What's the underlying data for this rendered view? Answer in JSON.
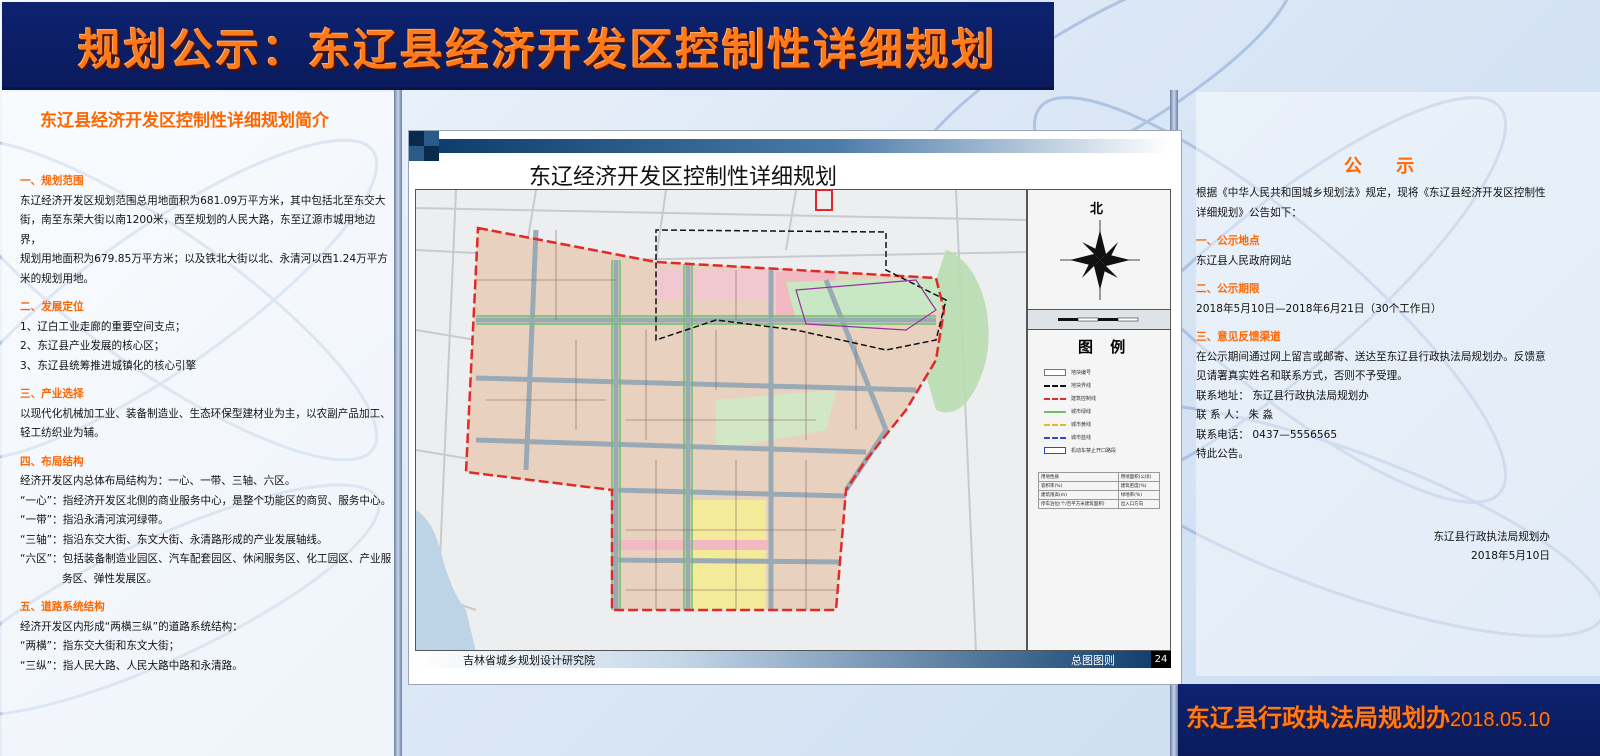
{
  "header": {
    "title": "规划公示：东辽县经济开发区控制性详细规划"
  },
  "intro": {
    "title": "东辽县经济开发区控制性详细规划简介",
    "sections": [
      {
        "heading": "一、规划范围",
        "lines": [
          "东辽经济开发区规划范围总用地面积为681.09万平方米，其中包括北至东交大",
          "街，南至东荣大街以南1200米，西至规划的人民大路，东至辽源市城用地边界，",
          "规划用地面积为679.85万平方米；以及铁北大街以北、永清河以西1.24万平方",
          "米的规划用地。"
        ]
      },
      {
        "heading": "二、发展定位",
        "lines": [
          "1、辽白工业走廊的重要空间支点；",
          "2、东辽县产业发展的核心区；",
          "3、东辽县统筹推进城镇化的核心引擎"
        ]
      },
      {
        "heading": "三、产业选择",
        "lines": [
          "以现代化机械加工业、装备制造业、生态环保型建材业为主，以农副产品加工、",
          "轻工纺织业为辅。"
        ]
      },
      {
        "heading": "四、布局结构",
        "lines": [
          "经济开发区内总体布局结构为：一心、一带、三轴、六区。",
          "“一心”：指经济开发区北侧的商业服务中心，是整个功能区的商贸、服务中心。",
          "“一带”：指沿永清河滨河绿带。",
          "“三轴”：指沿东交大街、东文大街、永清路形成的产业发展轴线。",
          "“六区”：包括装备制造业园区、汽车配套园区、休闲服务区、化工园区、产业服",
          "务区、弹性发展区。"
        ]
      },
      {
        "heading": "五、道路系统结构",
        "lines": [
          "经济开发区内形成“两横三纵”的道路系统结构：",
          "“两横”：指东交大街和东文大街；",
          "“三纵”：指人民大路、人民大路中路和永清路。"
        ]
      }
    ]
  },
  "map": {
    "title": "东辽经济开发区控制性详细规划",
    "north_label": "北",
    "legend_title": "图 例",
    "legend_items": [
      "地块编号",
      "地块界线",
      "建筑控制线",
      "城市绿线",
      "城市黄线",
      "城市蓝线",
      "机动车禁止开口路段"
    ],
    "stats_rows": [
      [
        "用地性质",
        "用地面积(公顷)"
      ],
      [
        "容积率(%)",
        "建筑密度(%)"
      ],
      [
        "建筑限高(m)",
        "绿地率(%)"
      ],
      [
        "停车泊位(个/百平方米建筑面积)",
        "出入口方向"
      ]
    ],
    "institute": "吉林省城乡规划设计研究院",
    "drawing_name": "总图图则",
    "page_number": "24"
  },
  "notice": {
    "heading": "公 示",
    "intro_lines": [
      "根据《中华人民共和国城乡规划法》规定，现将《东辽县经济开发区控制性",
      "详细规划》公告如下："
    ],
    "sections": [
      {
        "heading": "一、公示地点",
        "lines": [
          "东辽县人民政府网站"
        ]
      },
      {
        "heading": "二、公示期限",
        "lines": [
          "2018年5月10日—2018年6月21日（30个工作日）"
        ]
      },
      {
        "heading": "三、意见反馈渠道",
        "lines": [
          "在公示期间通过网上留言或邮寄、送达至东辽县行政执法局规划办。反馈意",
          "见请署真实姓名和联系方式，否则不予受理。",
          "联系地址：  东辽县行政执法局规划办",
          "联 系 人：  朱    淼",
          "联系电话：  0437—5556565",
          "特此公告。"
        ]
      }
    ],
    "signature_org": "东辽县行政执法局规划办",
    "signature_date": "2018年5月10日"
  },
  "footer": {
    "org": "东辽县行政执法局规划办",
    "date": "2018.05.10"
  },
  "colors": {
    "banner_navy": "#0a1a5c",
    "title_orange": "#ff7a1a",
    "heading_orange": "#ff6600"
  }
}
